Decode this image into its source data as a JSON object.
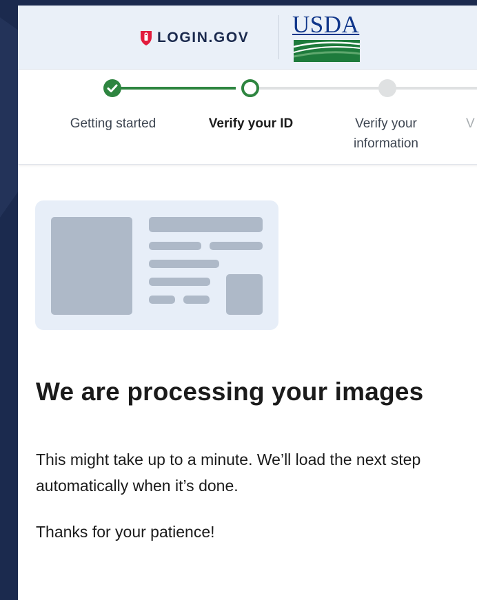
{
  "header": {
    "login_logo_text": "LOGIN.GOV",
    "partner_logo_text": "USDA"
  },
  "stepper": {
    "steps": [
      {
        "label": "Getting started",
        "state": "complete"
      },
      {
        "label": "Verify your ID",
        "state": "current"
      },
      {
        "label": "Verify your information",
        "state": "upcoming"
      },
      {
        "label": "V",
        "state": "upcoming-truncated"
      }
    ]
  },
  "main": {
    "heading": "We are processing your images",
    "body_1": "This might take up to a minute. We’ll load the next step automatically when it’s done.",
    "body_2": "Thanks for your patience!"
  },
  "colors": {
    "complete": "#2e8540",
    "upcoming": "#dfe1e2",
    "header_bg": "#eaf0f8",
    "login_red": "#e21c3d",
    "usda_blue": "#10368a",
    "usda_green": "#1e7b3c"
  },
  "icons": [
    "shield-logo-icon",
    "check-icon"
  ]
}
